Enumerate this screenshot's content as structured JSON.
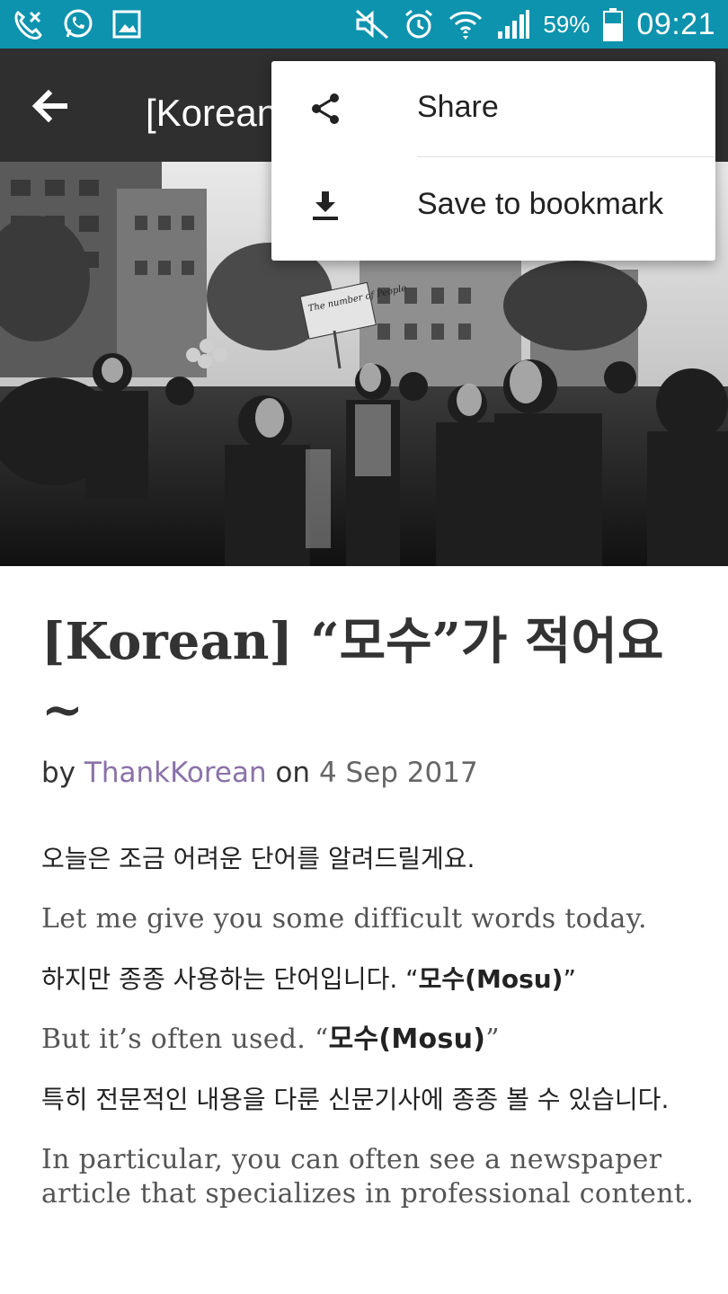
{
  "status_bar": {
    "battery": "59%",
    "time": "09:21",
    "left_icons": [
      "missed-call-icon",
      "whatsapp-icon",
      "gallery-icon"
    ],
    "right_icons": [
      "mute-icon",
      "alarm-icon",
      "wifi-icon",
      "signal-icon",
      "battery-icon"
    ],
    "background": "#0d93ad"
  },
  "app_bar": {
    "title": "[Korean] “모수”가 적어요~",
    "background": "#2f2f2f"
  },
  "menu": {
    "share_label": "Share",
    "save_label": "Save to bookmark"
  },
  "hero": {
    "sign_text": "The number of People"
  },
  "article": {
    "title": "[Korean] “모수”가 적어요~",
    "byline": {
      "by": "by",
      "author": "ThankKorean",
      "on": "on",
      "date": "4 Sep 2017",
      "author_color": "#8a72a8"
    },
    "p1_ko": "오늘은 조금 어려운 단어를 알려드릴게요.",
    "p1_en": "Let me give you some difficult words today.",
    "p2_ko_prefix": "하지만 종종 사용하는 단어입니다. “",
    "p2_ko_strong": "모수(Mosu)",
    "p2_ko_suffix": "”",
    "p2_en_prefix": "But it’s often used. “",
    "p2_en_strong": "모수(Mosu)",
    "p2_en_suffix": "”",
    "p3_ko": "특히 전문적인 내용을 다룬 신문기사에 종종 볼 수 있습니다.",
    "p3_en": "In particular, you can often see a newspaper article that specializes in professional content."
  }
}
